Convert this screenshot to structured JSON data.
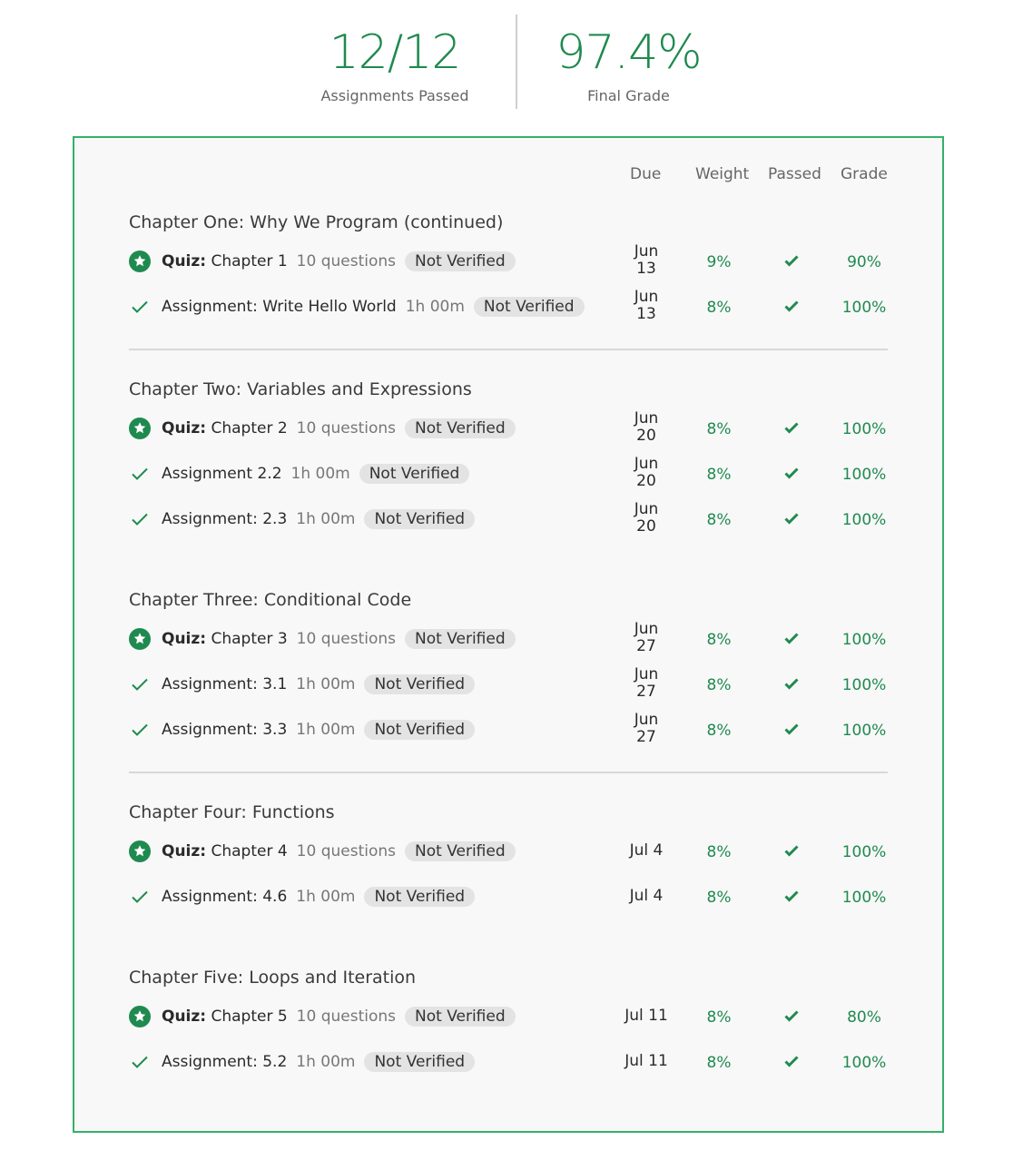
{
  "summary": {
    "assignments_passed_value": "12/12",
    "assignments_passed_label": "Assignments Passed",
    "final_grade_value": "97.4%",
    "final_grade_label": "Final Grade"
  },
  "columns": {
    "due": "Due",
    "weight": "Weight",
    "passed": "Passed",
    "grade": "Grade"
  },
  "colors": {
    "accent": "#1f8a4f",
    "border": "#35b06a",
    "badge_bg": "#e3e3e3"
  },
  "chapters": [
    {
      "title": "Chapter One: Why We Program (continued)",
      "items": [
        {
          "type": "quiz",
          "label_bold": "Quiz:",
          "label": "Chapter 1",
          "meta": "10 questions",
          "badge": "Not Verified",
          "due_month": "Jun",
          "due_day": "13",
          "weight": "9%",
          "passed_icon": "check-icon",
          "grade": "90%"
        },
        {
          "type": "assignment",
          "label_bold": "",
          "label": "Assignment: Write Hello World",
          "meta": "1h 00m",
          "badge": "Not Verified",
          "due_month": "Jun",
          "due_day": "13",
          "weight": "8%",
          "passed_icon": "check-icon",
          "grade": "100%"
        }
      ]
    },
    {
      "title": "Chapter Two: Variables and Expressions",
      "items": [
        {
          "type": "quiz",
          "label_bold": "Quiz:",
          "label": "Chapter 2",
          "meta": "10 questions",
          "badge": "Not Verified",
          "due_month": "Jun",
          "due_day": "20",
          "weight": "8%",
          "passed_icon": "check-icon",
          "grade": "100%"
        },
        {
          "type": "assignment",
          "label_bold": "",
          "label": "Assignment 2.2",
          "meta": "1h 00m",
          "badge": "Not Verified",
          "due_month": "Jun",
          "due_day": "20",
          "weight": "8%",
          "passed_icon": "check-icon",
          "grade": "100%"
        },
        {
          "type": "assignment",
          "label_bold": "",
          "label": "Assignment: 2.3",
          "meta": "1h 00m",
          "badge": "Not Verified",
          "due_month": "Jun",
          "due_day": "20",
          "weight": "8%",
          "passed_icon": "check-icon",
          "grade": "100%"
        }
      ]
    },
    {
      "title": "Chapter Three: Conditional Code",
      "items": [
        {
          "type": "quiz",
          "label_bold": "Quiz:",
          "label": "Chapter 3",
          "meta": "10 questions",
          "badge": "Not Verified",
          "due_month": "Jun",
          "due_day": "27",
          "weight": "8%",
          "passed_icon": "check-icon",
          "grade": "100%"
        },
        {
          "type": "assignment",
          "label_bold": "",
          "label": "Assignment: 3.1",
          "meta": "1h 00m",
          "badge": "Not Verified",
          "due_month": "Jun",
          "due_day": "27",
          "weight": "8%",
          "passed_icon": "check-icon",
          "grade": "100%"
        },
        {
          "type": "assignment",
          "label_bold": "",
          "label": "Assignment: 3.3",
          "meta": "1h 00m",
          "badge": "Not Verified",
          "due_month": "Jun",
          "due_day": "27",
          "weight": "8%",
          "passed_icon": "check-icon",
          "grade": "100%"
        }
      ]
    },
    {
      "title": "Chapter Four: Functions",
      "items": [
        {
          "type": "quiz",
          "label_bold": "Quiz:",
          "label": "Chapter 4",
          "meta": "10 questions",
          "badge": "Not Verified",
          "due": "Jul 4",
          "weight": "8%",
          "passed_icon": "check-icon",
          "grade": "100%"
        },
        {
          "type": "assignment",
          "label_bold": "",
          "label": "Assignment: 4.6",
          "meta": "1h 00m",
          "badge": "Not Verified",
          "due": "Jul 4",
          "weight": "8%",
          "passed_icon": "check-icon",
          "grade": "100%"
        }
      ]
    },
    {
      "title": "Chapter Five: Loops and Iteration",
      "items": [
        {
          "type": "quiz",
          "label_bold": "Quiz:",
          "label": "Chapter 5",
          "meta": "10 questions",
          "badge": "Not Verified",
          "due": "Jul 11",
          "weight": "8%",
          "passed_icon": "check-icon",
          "grade": "80%"
        },
        {
          "type": "assignment",
          "label_bold": "",
          "label": "Assignment: 5.2",
          "meta": "1h 00m",
          "badge": "Not Verified",
          "due": "Jul 11",
          "weight": "8%",
          "passed_icon": "check-icon",
          "grade": "100%"
        }
      ]
    }
  ]
}
